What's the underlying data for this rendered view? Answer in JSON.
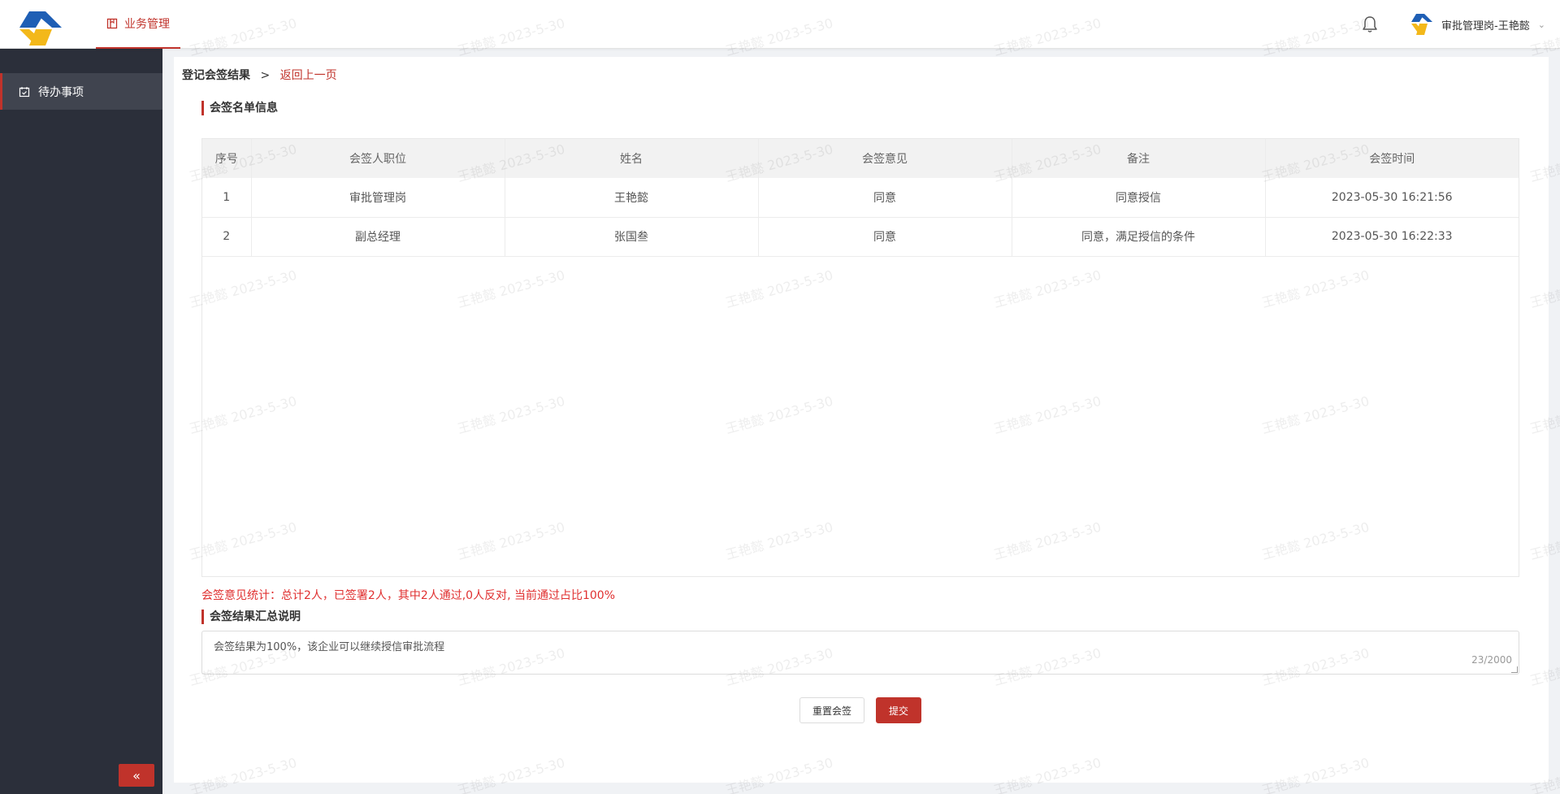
{
  "topbar": {
    "nav_tab_label": "业务管理",
    "user_label": "审批管理岗-王艳懿",
    "chevron": "⌄"
  },
  "sidebar": {
    "items": [
      {
        "label": "待办事项",
        "icon": "calendar-check-icon"
      }
    ],
    "collapse_label": "«"
  },
  "breadcrumb": {
    "current": "登记会签结果",
    "separator": ">",
    "back": "返回上一页"
  },
  "section1_title": "会签名单信息",
  "table": {
    "headers": [
      "序号",
      "会签人职位",
      "姓名",
      "会签意见",
      "备注",
      "会签时间"
    ],
    "rows": [
      [
        "1",
        "审批管理岗",
        "王艳懿",
        "同意",
        "同意授信",
        "2023-05-30 16:21:56"
      ],
      [
        "2",
        "副总经理",
        "张国叁",
        "同意",
        "同意，满足授信的条件",
        "2023-05-30 16:22:33"
      ]
    ]
  },
  "stats_text": "会签意见统计：总计2人，已签署2人，其中2人通过,0人反对, 当前通过占比100%",
  "section2_title": "会签结果汇总说明",
  "summary": {
    "value": "会签结果为100%，该企业可以继续授信审批流程",
    "counter": "23/2000"
  },
  "buttons": {
    "reset": "重置会签",
    "submit": "提交"
  },
  "watermark_text": "王艳懿 2023-5-30",
  "colors": {
    "accent": "#c0332b",
    "sidebar_bg": "#2b2f3a",
    "stats_red": "#e03030"
  }
}
